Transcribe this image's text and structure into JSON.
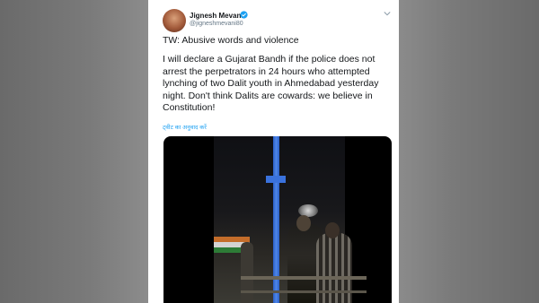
{
  "tweet": {
    "author_name": "Jignesh Mevani",
    "author_handle": "@jigneshmevani80",
    "title": "TW: Abusive words and violence",
    "body": "I will declare a Gujarat Bandh if the police does not arrest the perpetrators in 24 hours who attempted lynching of two Dalit youth in Ahmedabad yesterday night. Don't think Dalits are cowards: we believe in Constitution!",
    "translate_label": "ट्वीट का अनुवाद करें",
    "accent_color": "#1da1f2"
  },
  "icons": {
    "verified": "verified-badge-icon",
    "menu": "chevron-down-icon"
  }
}
